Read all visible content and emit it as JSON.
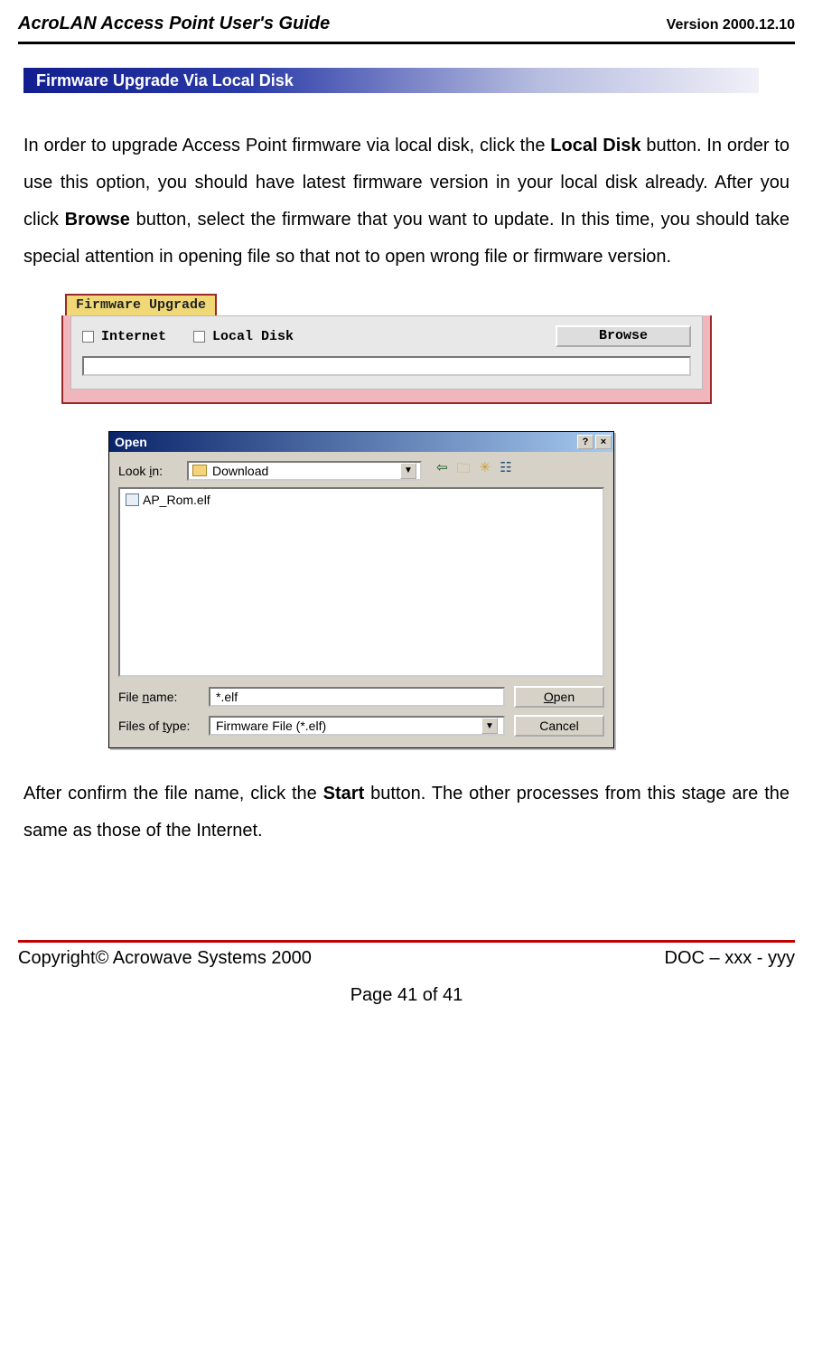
{
  "header": {
    "doc_title": "AcroLAN Access Point User's Guide",
    "version": "Version 2000.12.10"
  },
  "section": {
    "heading": "Firmware Upgrade Via Local Disk"
  },
  "para1": {
    "t1": "In order to upgrade Access Point firmware via local disk, click the ",
    "b1": "Local Disk",
    "t2": " button. In order to use this option, you should have latest firmware version in your local disk already. After you click ",
    "b2": "Browse",
    "t3": " button, select the firmware that you want to update. In this time, you should take special attention in opening file so that not to open wrong file or firmware version."
  },
  "fw_panel": {
    "tab_label": "Firmware Upgrade",
    "internet": "Internet",
    "localdisk": "Local Disk",
    "browse": "Browse"
  },
  "open_dialog": {
    "title": "Open",
    "help": "?",
    "close": "×",
    "look_in_label": "Look in:",
    "folder_name": "Download",
    "file_item": "AP_Rom.elf",
    "file_name_label_pre": "File ",
    "file_name_label_u": "n",
    "file_name_label_post": "ame:",
    "file_name_value": "*.elf",
    "files_of_type_label_pre": "Files of ",
    "files_of_type_label_u": "t",
    "files_of_type_label_post": "ype:",
    "files_of_type_value": "Firmware File (*.elf)",
    "open_btn_u": "O",
    "open_btn_rest": "pen",
    "cancel_btn": "Cancel",
    "nav_back": "⇦",
    "nav_up": "🗀",
    "nav_new": "✳",
    "nav_view": "☷"
  },
  "para2": {
    "t1": "After confirm the file name, click the ",
    "b1": "Start",
    "t2": " button. The other processes from this stage are the same as those of the Internet."
  },
  "footer": {
    "copyright": "Copyright© Acrowave Systems 2000",
    "docnum": "DOC – xxx - yyy",
    "page": "Page 41 of 41"
  }
}
